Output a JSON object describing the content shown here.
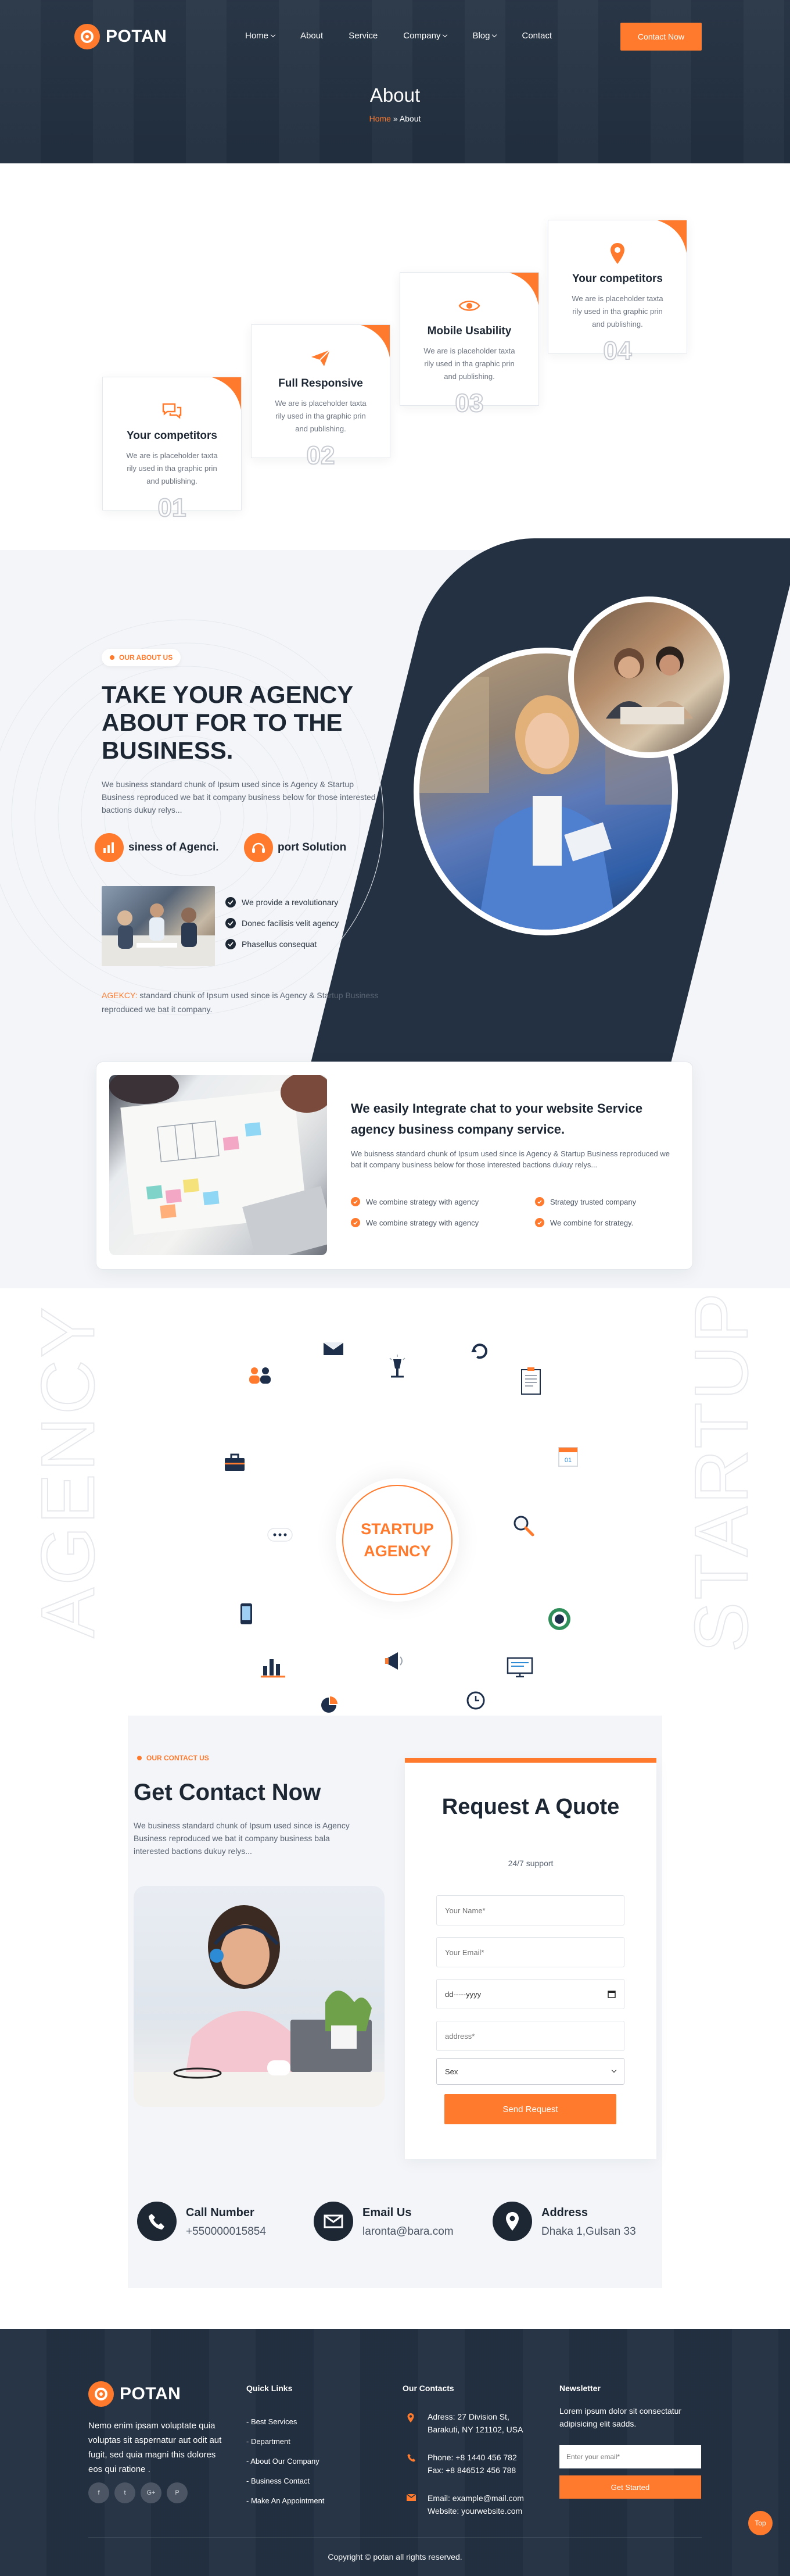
{
  "brand": {
    "name": "POTAN",
    "accent": "#ff7a2d",
    "navy": "#233142"
  },
  "nav": {
    "items": [
      {
        "label": "Home",
        "dropdown": true
      },
      {
        "label": "About",
        "dropdown": false
      },
      {
        "label": "Service",
        "dropdown": false
      },
      {
        "label": "Company",
        "dropdown": true
      },
      {
        "label": "Blog",
        "dropdown": true
      },
      {
        "label": "Contact",
        "dropdown": false
      }
    ],
    "cta": "Contact Now"
  },
  "hero": {
    "title": "About",
    "crumb_home": "Home",
    "crumb_sep": "»",
    "crumb_current": "About"
  },
  "features": [
    {
      "title": "Your competitors",
      "text": "We are is placeholder taxta rily used in tha graphic prin and publishing.",
      "num": "01",
      "icon": "chat-bubbles-icon"
    },
    {
      "title": "Full Responsive",
      "text": "We are is placeholder taxta rily used in tha graphic prin and publishing.",
      "num": "02",
      "icon": "paper-plane-icon"
    },
    {
      "title": "Mobile Usability",
      "text": "We are is placeholder taxta rily used in tha graphic prin and publishing.",
      "num": "03",
      "icon": "eye-icon"
    },
    {
      "title": "Your competitors",
      "text": "We are is placeholder taxta rily used in tha graphic prin and publishing.",
      "num": "04",
      "icon": "map-pin-icon"
    }
  ],
  "about": {
    "tag": "OUR ABOUT US",
    "heading": "TAKE YOUR AGENCY ABOUT FOR TO THE BUSINESS.",
    "lead": "We business standard chunk of Ipsum used since is Agency & Startup Business reproduced we bat it company business below for those interested bactions dukuy relys...",
    "box1": "siness of Agenci.",
    "box2": "port Solution",
    "checks": [
      "We provide a revolutionary",
      "Donec facilisis velit agency",
      "Phasellus consequat"
    ],
    "note_hl": "AGEKCY:",
    "note": " standard chunk of Ipsum used since is Agency & Startup Business reproduced we bat it company."
  },
  "integrate": {
    "heading": "We easily Integrate chat to your website Service agency business company service.",
    "text": "We buisness standard chunk of Ipsum used since is Agency & Startup Business reproduced we bat it company business below for those interested bactions dukuy relys...",
    "items": [
      "We combine strategy with agency",
      "Strategy trusted company",
      "We combine strategy with agency",
      "We combine for strategy."
    ]
  },
  "orbit": {
    "left_word": "AGENCY",
    "right_word": "STARTUP",
    "center_line1": "STARTUP",
    "center_line2": "AGENCY"
  },
  "contact": {
    "tag": "OUR CONTACT US",
    "heading": "Get Contact Now",
    "text": "We business standard chunk of Ipsum used since is Agency Business reproduced we bat it company business bala interested bactions dukuy relys...",
    "quote_title": "Request A Quote",
    "quote_sub": "24/7 support",
    "name_ph": "Your Name*",
    "email_ph": "Your Email*",
    "date_ph": "dd-----yyyy",
    "address_ph": "address*",
    "sex_value": "Sex",
    "send": "Send Request",
    "info": [
      {
        "title": "Call Number",
        "value": "+550000015854",
        "icon": "phone-icon"
      },
      {
        "title": "Email Us",
        "value": "laronta@bara.com",
        "icon": "email-icon"
      },
      {
        "title": "Address",
        "value": "Dhaka 1,Gulsan 33",
        "icon": "map-pin-icon"
      }
    ]
  },
  "footer": {
    "desc": "Nemo enim ipsam voluptate quia voluptas sit aspernatur aut odit aut fugit, sed quia magni this dolores eos qui ratione .",
    "social": [
      "f",
      "t",
      "G+",
      "P"
    ],
    "quick_title": "Quick Links",
    "quick": [
      "- Best Services",
      "- Department",
      "- About Our Company",
      "- Business Contact",
      "- Make An Appointment"
    ],
    "contacts_title": "Our Contacts",
    "addr1": "Adress: 27 Division St,",
    "addr2": "Barakuti, NY 121102, USA",
    "phone1": "Phone: +8 1440 456 782",
    "phone2": "Fax: +8 846512 456 788",
    "mail1": "Email: example@mail.com",
    "mail2": "Website: yourwebsite.com",
    "news_title": "Newsletter",
    "news_desc": "Lorem ipsum dolor sit consectatur adipisicing elit sadds.",
    "news_ph": "Enter your email*",
    "news_btn": "Get Started",
    "copyright": "Copyright © potan all rights reserved.",
    "top": "Top"
  }
}
